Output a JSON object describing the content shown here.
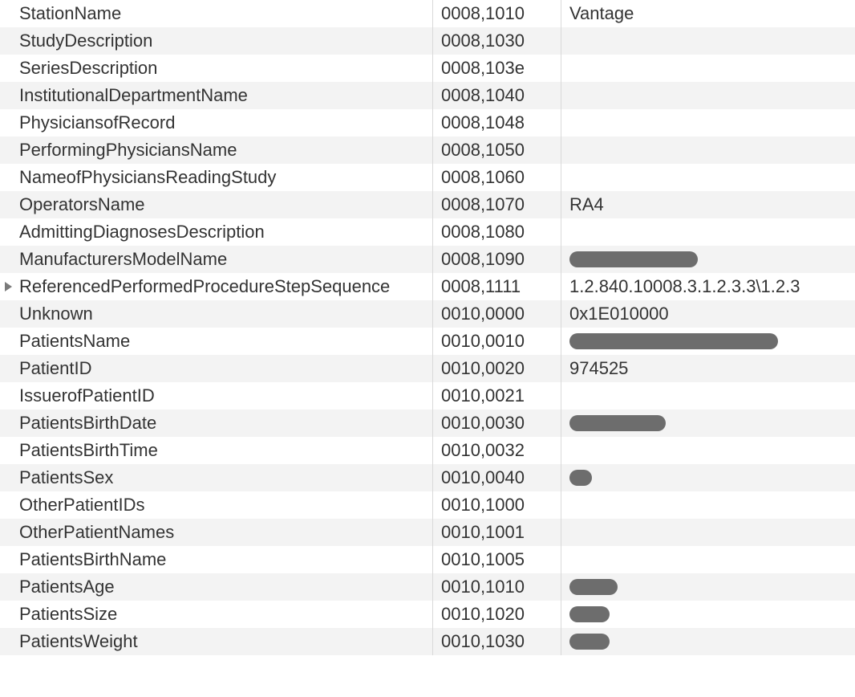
{
  "rows": [
    {
      "name": "StationName",
      "tag": "0008,1010",
      "value": "Vantage",
      "expandable": false,
      "redacted": false
    },
    {
      "name": "StudyDescription",
      "tag": "0008,1030",
      "value": "",
      "expandable": false,
      "redacted": false
    },
    {
      "name": "SeriesDescription",
      "tag": "0008,103e",
      "value": "",
      "expandable": false,
      "redacted": false
    },
    {
      "name": "InstitutionalDepartmentName",
      "tag": "0008,1040",
      "value": "",
      "expandable": false,
      "redacted": false
    },
    {
      "name": "PhysiciansofRecord",
      "tag": "0008,1048",
      "value": "",
      "expandable": false,
      "redacted": false
    },
    {
      "name": "PerformingPhysiciansName",
      "tag": "0008,1050",
      "value": "",
      "expandable": false,
      "redacted": false
    },
    {
      "name": "NameofPhysiciansReadingStudy",
      "tag": "0008,1060",
      "value": "",
      "expandable": false,
      "redacted": false
    },
    {
      "name": "OperatorsName",
      "tag": "0008,1070",
      "value": "RA4",
      "expandable": false,
      "redacted": false
    },
    {
      "name": "AdmittingDiagnosesDescription",
      "tag": "0008,1080",
      "value": "",
      "expandable": false,
      "redacted": false
    },
    {
      "name": "ManufacturersModelName",
      "tag": "0008,1090",
      "value": "",
      "expandable": false,
      "redacted": true,
      "redactedWidth": 160
    },
    {
      "name": "ReferencedPerformedProcedureStepSequence",
      "tag": "0008,1111",
      "value": "1.2.840.10008.3.1.2.3.3\\1.2.3",
      "expandable": true,
      "redacted": false
    },
    {
      "name": "Unknown",
      "tag": "0010,0000",
      "value": "0x1E010000",
      "expandable": false,
      "redacted": false
    },
    {
      "name": "PatientsName",
      "tag": "0010,0010",
      "value": "",
      "expandable": false,
      "redacted": true,
      "redactedWidth": 260
    },
    {
      "name": "PatientID",
      "tag": "0010,0020",
      "value": "974525",
      "expandable": false,
      "redacted": false
    },
    {
      "name": "IssuerofPatientID",
      "tag": "0010,0021",
      "value": "",
      "expandable": false,
      "redacted": false
    },
    {
      "name": "PatientsBirthDate",
      "tag": "0010,0030",
      "value": "",
      "expandable": false,
      "redacted": true,
      "redactedWidth": 120
    },
    {
      "name": "PatientsBirthTime",
      "tag": "0010,0032",
      "value": "",
      "expandable": false,
      "redacted": false
    },
    {
      "name": "PatientsSex",
      "tag": "0010,0040",
      "value": "",
      "expandable": false,
      "redacted": true,
      "redactedWidth": 28
    },
    {
      "name": "OtherPatientIDs",
      "tag": "0010,1000",
      "value": "",
      "expandable": false,
      "redacted": false
    },
    {
      "name": "OtherPatientNames",
      "tag": "0010,1001",
      "value": "",
      "expandable": false,
      "redacted": false
    },
    {
      "name": "PatientsBirthName",
      "tag": "0010,1005",
      "value": "",
      "expandable": false,
      "redacted": false
    },
    {
      "name": "PatientsAge",
      "tag": "0010,1010",
      "value": "",
      "expandable": false,
      "redacted": true,
      "redactedWidth": 60
    },
    {
      "name": "PatientsSize",
      "tag": "0010,1020",
      "value": "",
      "expandable": false,
      "redacted": true,
      "redactedWidth": 50
    },
    {
      "name": "PatientsWeight",
      "tag": "0010,1030",
      "value": "",
      "expandable": false,
      "redacted": true,
      "redactedWidth": 50
    }
  ]
}
